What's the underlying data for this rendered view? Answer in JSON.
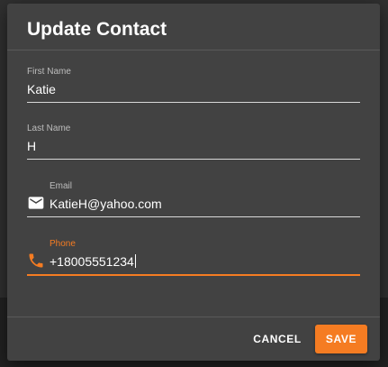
{
  "dialog": {
    "title": "Update Contact"
  },
  "fields": {
    "first_name": {
      "label": "First Name",
      "value": "Katie"
    },
    "last_name": {
      "label": "Last Name",
      "value": "H"
    },
    "email": {
      "label": "Email",
      "value": "KatieH@yahoo.com",
      "icon": "mail-icon"
    },
    "phone": {
      "label": "Phone",
      "value": "+18005551234",
      "icon": "phone-icon",
      "focused": true
    }
  },
  "actions": {
    "cancel_label": "CANCEL",
    "save_label": "SAVE"
  },
  "colors": {
    "dialog_background": "#424242",
    "accent": "#f57c22",
    "text": "#ffffff",
    "label": "#bdbdbd"
  }
}
